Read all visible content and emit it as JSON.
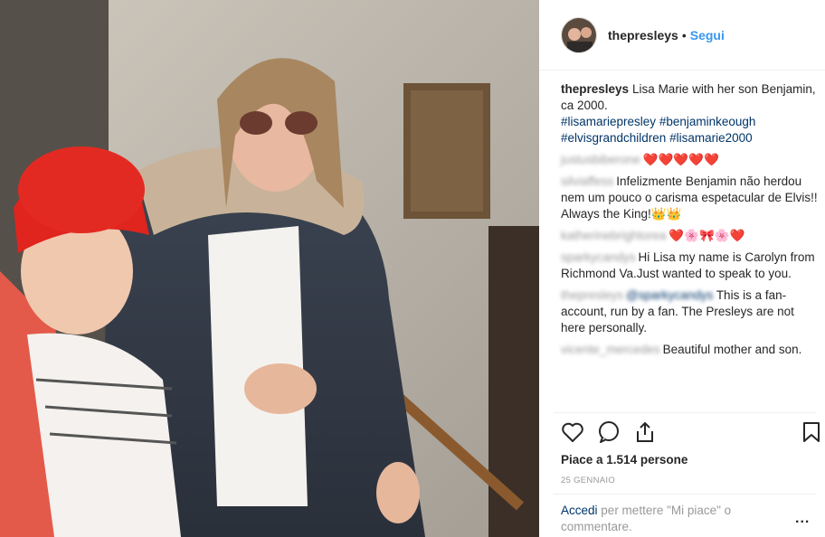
{
  "photo": {
    "alt_name": "lisa-marie-and-benjamin-photo"
  },
  "header": {
    "username": "thepresleys",
    "separator": "•",
    "follow_label": "Segui"
  },
  "caption": {
    "username": "thepresleys",
    "text": "Lisa Marie with her son Benjamin, ca 2000.",
    "hashtags": [
      "#lisamariepresley",
      "#benjaminkeough",
      "#elvisgrandchildren",
      "#lisamarie2000"
    ]
  },
  "comments": [
    {
      "text": "❤️❤️❤️❤️❤️"
    },
    {
      "text": "Infelizmente Benjamin não herdou nem um pouco o carisma espetacular de Elvis!! Always the King!👑👑"
    },
    {
      "text": "❤️🌸🎀🌸❤️"
    },
    {
      "text": "Hi Lisa my name is Carolyn from Richmond Va.Just wanted to speak to you."
    },
    {
      "text": "This is a fan-account, run by a fan. The Presleys are not here personally."
    },
    {
      "text": "Beautiful mother and son."
    }
  ],
  "actions": {
    "like_icon": "heart-icon",
    "comment_icon": "comment-icon",
    "share_icon": "share-icon",
    "save_icon": "bookmark-icon"
  },
  "likes": "Piace a 1.514 persone",
  "date": "25 GENNAIO",
  "login": {
    "link": "Accedi",
    "rest": "per mettere \"Mi piace\" o commentare."
  },
  "more_label": "..."
}
